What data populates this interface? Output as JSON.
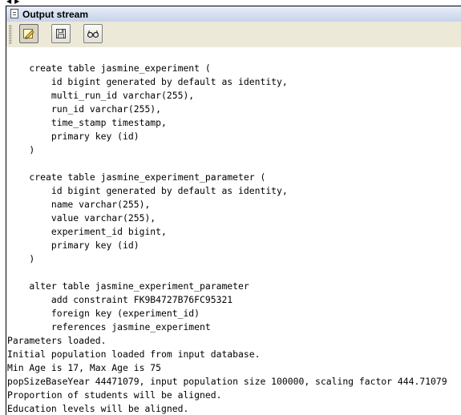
{
  "window": {
    "title": "Output stream"
  },
  "toolbar": {
    "buttons": [
      {
        "name": "clear-button",
        "icon": "eraser-icon",
        "pressed": true
      },
      {
        "name": "save-button",
        "icon": "save-icon",
        "pressed": false
      },
      {
        "name": "find-button",
        "icon": "glasses-icon",
        "pressed": false
      }
    ]
  },
  "output": {
    "lines": [
      "",
      "    create table jasmine_experiment (",
      "        id bigint generated by default as identity,",
      "        multi_run_id varchar(255),",
      "        run_id varchar(255),",
      "        time_stamp timestamp,",
      "        primary key (id)",
      "    )",
      "",
      "    create table jasmine_experiment_parameter (",
      "        id bigint generated by default as identity,",
      "        name varchar(255),",
      "        value varchar(255),",
      "        experiment_id bigint,",
      "        primary key (id)",
      "    )",
      "",
      "    alter table jasmine_experiment_parameter",
      "        add constraint FK9B4727B76FC95321",
      "        foreign key (experiment_id)",
      "        references jasmine_experiment",
      "Parameters loaded.",
      "Initial population loaded from input database.",
      "Min Age is 17, Max Age is 75",
      "popSizeBaseYear 44471079, input population size 100000, scaling factor 444.71079",
      "Proportion of students will be aligned.",
      "Education levels will be aligned."
    ]
  }
}
